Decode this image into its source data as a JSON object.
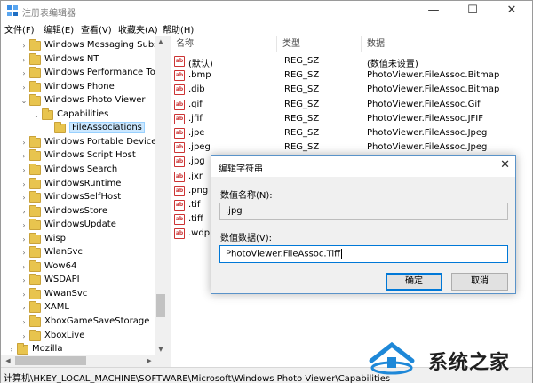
{
  "window": {
    "title": "注册表编辑器",
    "minimize": "—",
    "maximize": "☐",
    "close": "✕"
  },
  "menu": [
    "文件(F)",
    "编辑(E)",
    "查看(V)",
    "收藏夹(A)",
    "帮助(H)"
  ],
  "tree": [
    {
      "label": "Windows Messaging Subsys",
      "expander": "›"
    },
    {
      "label": "Windows NT",
      "expander": "›"
    },
    {
      "label": "Windows Performance Tool",
      "expander": "›"
    },
    {
      "label": "Windows Phone",
      "expander": "›"
    },
    {
      "label": "Windows Photo Viewer",
      "expander": "⌄"
    },
    {
      "label": "Capabilities",
      "expander": "⌄"
    },
    {
      "label": "FileAssociations",
      "expander": ""
    },
    {
      "label": "Windows Portable Devices",
      "expander": "›"
    },
    {
      "label": "Windows Script Host",
      "expander": "›"
    },
    {
      "label": "Windows Search",
      "expander": "›"
    },
    {
      "label": "WindowsRuntime",
      "expander": "›"
    },
    {
      "label": "WindowsSelfHost",
      "expander": "›"
    },
    {
      "label": "WindowsStore",
      "expander": "›"
    },
    {
      "label": "WindowsUpdate",
      "expander": "›"
    },
    {
      "label": "Wisp",
      "expander": "›"
    },
    {
      "label": "WlanSvc",
      "expander": "›"
    },
    {
      "label": "Wow64",
      "expander": "›"
    },
    {
      "label": "WSDAPI",
      "expander": "›"
    },
    {
      "label": "WwanSvc",
      "expander": "›"
    },
    {
      "label": "XAML",
      "expander": "›"
    },
    {
      "label": "XboxGameSaveStorage",
      "expander": "›"
    },
    {
      "label": "XboxLive",
      "expander": "›"
    },
    {
      "label": "Mozilla",
      "expander": "›"
    }
  ],
  "list": {
    "columns": [
      "名称",
      "类型",
      "数据"
    ],
    "rows": [
      {
        "icon": "ab",
        "name": "(默认)",
        "type": "REG_SZ",
        "data": "(数值未设置)"
      },
      {
        "icon": "ab",
        "name": ".bmp",
        "type": "REG_SZ",
        "data": "PhotoViewer.FileAssoc.Bitmap"
      },
      {
        "icon": "ab",
        "name": ".dib",
        "type": "REG_SZ",
        "data": "PhotoViewer.FileAssoc.Bitmap"
      },
      {
        "icon": "ab",
        "name": ".gif",
        "type": "REG_SZ",
        "data": "PhotoViewer.FileAssoc.Gif"
      },
      {
        "icon": "ab",
        "name": ".jfif",
        "type": "REG_SZ",
        "data": "PhotoViewer.FileAssoc.JFIF"
      },
      {
        "icon": "ab",
        "name": ".jpe",
        "type": "REG_SZ",
        "data": "PhotoViewer.FileAssoc.Jpeg"
      },
      {
        "icon": "ab",
        "name": ".jpeg",
        "type": "REG_SZ",
        "data": "PhotoViewer.FileAssoc.Jpeg"
      },
      {
        "icon": "ab",
        "name": ".jpg",
        "type": "",
        "data": ""
      },
      {
        "icon": "ab",
        "name": ".jxr",
        "type": "",
        "data": ""
      },
      {
        "icon": "ab",
        "name": ".png",
        "type": "",
        "data": ""
      },
      {
        "icon": "ab",
        "name": ".tif",
        "type": "",
        "data": ""
      },
      {
        "icon": "ab",
        "name": ".tiff",
        "type": "",
        "data": ""
      },
      {
        "icon": "ab",
        "name": ".wdp",
        "type": "",
        "data": ""
      }
    ]
  },
  "status_path": "计算机\\HKEY_LOCAL_MACHINE\\SOFTWARE\\Microsoft\\Windows Photo Viewer\\Capabilities",
  "dialog": {
    "title": "编辑字符串",
    "close": "✕",
    "name_label": "数值名称(N):",
    "name_value": ".jpg",
    "data_label": "数值数据(V):",
    "data_value": "PhotoViewer.FileAssoc.Tiff",
    "ok": "确定",
    "cancel": "取消"
  },
  "watermark": {
    "text": "系统之家"
  },
  "colors": {
    "accent": "#0078d7",
    "selection": "#cce8ff",
    "folder": "#e8c44e",
    "string_icon": "#cc3333"
  }
}
